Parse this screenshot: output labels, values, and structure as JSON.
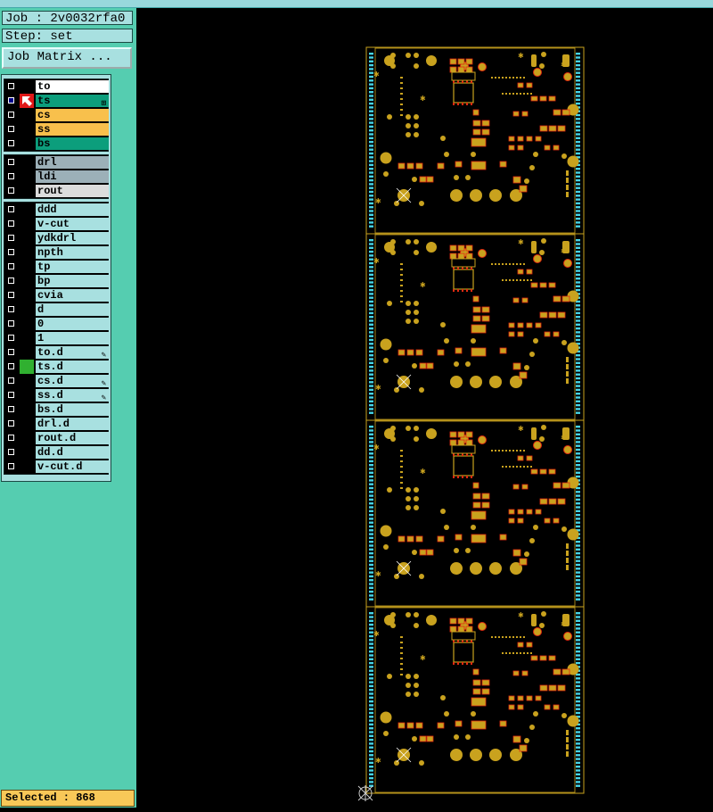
{
  "header": {
    "job": "Job : 2v0032rfa0",
    "step": "Step: set"
  },
  "job_matrix_button": "Job Matrix ...",
  "colors": {
    "green": "#0c9e7c",
    "orange": "#f8c04c",
    "white": "#ffffff",
    "grey": "#9cb0b8",
    "lightgrey": "#dcdcdc",
    "cyan": "#a8e0e0",
    "copper": "#c9a21e",
    "red": "#e01818"
  },
  "layer_groups": [
    [
      {
        "name": "to",
        "color": "white"
      },
      {
        "name": "ts",
        "color": "green",
        "work": true,
        "selected": true,
        "icon": "⊞"
      },
      {
        "name": "cs",
        "color": "orange"
      },
      {
        "name": "ss",
        "color": "orange"
      },
      {
        "name": "bs",
        "color": "green"
      }
    ],
    [
      {
        "name": "drl",
        "color": "grey"
      },
      {
        "name": "ldi",
        "color": "grey"
      },
      {
        "name": "rout",
        "color": "lightgrey"
      }
    ],
    [
      {
        "name": "ddd",
        "color": "cyan"
      },
      {
        "name": "v-cut",
        "color": "cyan"
      },
      {
        "name": "ydkdrl",
        "color": "cyan"
      },
      {
        "name": "npth",
        "color": "cyan"
      },
      {
        "name": "tp",
        "color": "cyan"
      },
      {
        "name": "bp",
        "color": "cyan"
      },
      {
        "name": "cvia",
        "color": "cyan"
      },
      {
        "name": "d",
        "color": "cyan"
      },
      {
        "name": "0",
        "color": "cyan"
      },
      {
        "name": "1",
        "color": "cyan"
      },
      {
        "name": "to.d",
        "color": "cyan",
        "icon": "✎"
      },
      {
        "name": "ts.d",
        "color": "cyan",
        "green_mark": true
      },
      {
        "name": "cs.d",
        "color": "cyan",
        "icon": "✎"
      },
      {
        "name": "ss.d",
        "color": "cyan",
        "icon": "✎"
      },
      {
        "name": "bs.d",
        "color": "cyan"
      },
      {
        "name": "drl.d",
        "color": "cyan"
      },
      {
        "name": "rout.d",
        "color": "cyan"
      },
      {
        "name": "dd.d",
        "color": "cyan"
      },
      {
        "name": "v-cut.d",
        "color": "cyan"
      }
    ]
  ],
  "status": "Selected : 868",
  "board": {
    "panel_count": 4
  }
}
